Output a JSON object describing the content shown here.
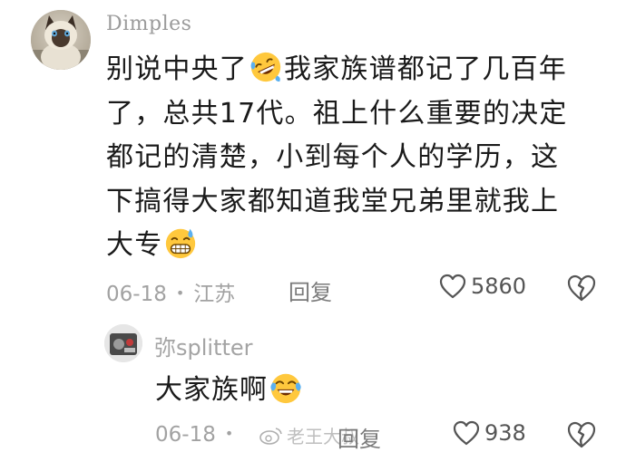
{
  "comment": {
    "username": "Dimples",
    "lines": [
      {
        "before": "别说中央了",
        "emoji": "rofl-face",
        "after": "我家族谱都记了几百年"
      },
      {
        "before": "了，总共17代。祖上什么重要的决定",
        "emoji": null,
        "after": ""
      },
      {
        "before": "都记的清楚，小到每个人的学历，这",
        "emoji": null,
        "after": ""
      },
      {
        "before": "下搞得大家都知道我堂兄弟里就我上",
        "emoji": null,
        "after": ""
      },
      {
        "before": "大专",
        "emoji": "sweat-grin-face",
        "after": ""
      }
    ],
    "date": "06-18",
    "separator": "•",
    "location": "江苏",
    "reply_label": "回复",
    "like_count": "5860"
  },
  "reply": {
    "username": "弥splitter",
    "text": "大家族啊",
    "emoji": "rofl-face",
    "date": "06-18",
    "reply_label": "回复",
    "like_count": "938"
  },
  "watermark": {
    "platform_icon": "weibo-icon",
    "handle": "老王大叔"
  },
  "colors": {
    "text": "#1a1a1a",
    "meta": "#a2a2a2",
    "username": "#9b9b9b",
    "emoji_yellow": "#ffc83d",
    "tear_blue": "#5ab0f0"
  }
}
